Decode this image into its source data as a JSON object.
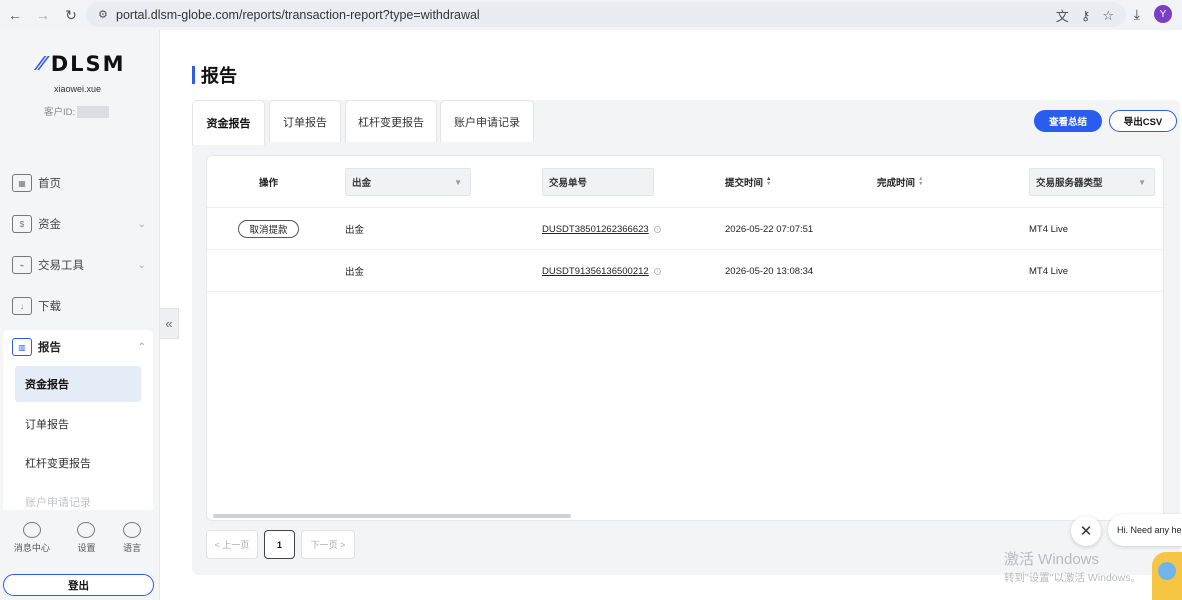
{
  "browser": {
    "url": "portal.dlsm-globe.com/reports/transaction-report?type=withdrawal",
    "profile_initial": "Y"
  },
  "sidebar": {
    "brand": "DLSM",
    "username": "xiaowei.xue",
    "client_id_label": "客户ID:",
    "nav": [
      {
        "label": "首页",
        "icon": "home-icon"
      },
      {
        "label": "资金",
        "icon": "wallet-icon"
      },
      {
        "label": "交易工具",
        "icon": "chart-tool-icon"
      },
      {
        "label": "下载",
        "icon": "download-icon"
      }
    ],
    "report_label": "报告",
    "report_subitems": [
      "资金报告",
      "订单报告",
      "杠杆变更报告",
      "账户申请记录"
    ],
    "bottom": [
      "消息中心",
      "设置",
      "语言"
    ],
    "logout": "登出"
  },
  "main": {
    "title": "报告",
    "tabs": [
      "资金报告",
      "订单报告",
      "杠杆变更报告",
      "账户申请记录"
    ],
    "active_tab": "资金报告",
    "summary_button": "查看总结",
    "csv_button": "导出CSV"
  },
  "table": {
    "headers": {
      "action": "操作",
      "type_filter": "出金",
      "txn_no": "交易单号",
      "submit_time": "提交时间",
      "complete_time": "完成时间",
      "server_type": "交易服务器类型"
    },
    "rows": [
      {
        "action": "取消提款",
        "type": "出金",
        "txn_no": "DUSDT38501262366623",
        "submit_time": "2026-05-22 07:07:51",
        "complete_time": "",
        "server": "MT4 Live"
      },
      {
        "action": "",
        "type": "出金",
        "txn_no": "DUSDT91356136500212",
        "submit_time": "2026-05-20 13:08:34",
        "complete_time": "",
        "server": "MT4 Live"
      }
    ]
  },
  "pager": {
    "prev": "< 上一页",
    "current": "1",
    "next": "下一页 >"
  },
  "chat": {
    "message": "Hi. Need any help?"
  },
  "watermark": {
    "line1": "激活 Windows",
    "line2": "转到\"设置\"以激活 Windows。"
  },
  "colors": {
    "accent": "#2a5cf0",
    "sidebar_bg": "#f4f5f7",
    "active_sub_bg": "#e6ebf8"
  }
}
